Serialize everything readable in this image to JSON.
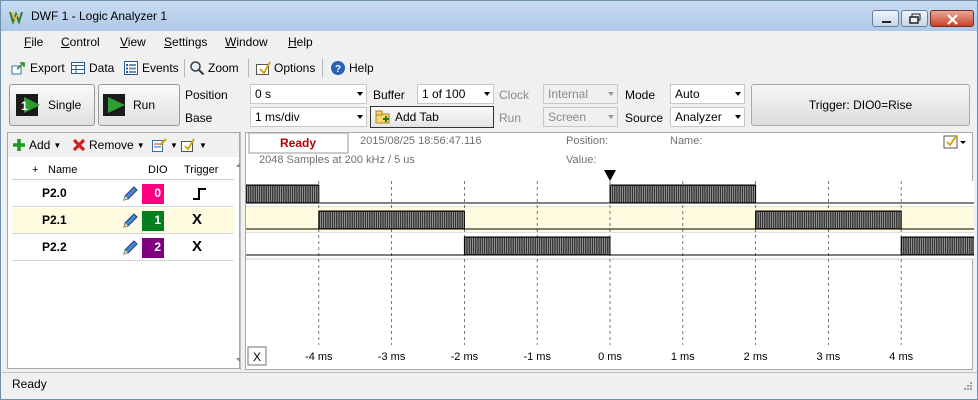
{
  "window": {
    "title": "DWF 1 - Logic Analyzer 1"
  },
  "menu": {
    "items": [
      {
        "first": "F",
        "rest": "ile"
      },
      {
        "first": "C",
        "rest": "ontrol"
      },
      {
        "first": "V",
        "rest": "iew"
      },
      {
        "first": "S",
        "rest": "ettings"
      },
      {
        "first": "W",
        "rest": "indow"
      },
      {
        "first": "H",
        "rest": "elp"
      }
    ]
  },
  "toolbar": {
    "export": "Export",
    "data": "Data",
    "events": "Events",
    "zoom": "Zoom",
    "options": "Options",
    "help": "Help"
  },
  "controls": {
    "single": "Single",
    "run": "Run",
    "position_label": "Position",
    "position_value": "0 s",
    "base_label": "Base",
    "base_value": "1 ms/div",
    "buffer_label": "Buffer",
    "buffer_value": "1 of 100",
    "add_tab": "Add Tab",
    "clock_label": "Clock",
    "clock_value": "Internal",
    "run_label": "Run",
    "run_value": "Screen",
    "mode_label": "Mode",
    "mode_value": "Auto",
    "source_label": "Source",
    "source_value": "Analyzer",
    "trigger_summary": "Trigger: DIO0=Rise"
  },
  "channels_panel": {
    "add": "Add",
    "remove": "Remove",
    "headers": {
      "plus": "+",
      "name": "Name",
      "dio": "DIO",
      "trigger": "Trigger"
    },
    "rows": [
      {
        "name": "P2.0",
        "dio": "0",
        "color": "#ff0080",
        "trigger": "rise"
      },
      {
        "name": "P2.1",
        "dio": "1",
        "color": "#007f1e",
        "trigger": "X"
      },
      {
        "name": "P2.2",
        "dio": "2",
        "color": "#800080",
        "trigger": "X"
      }
    ]
  },
  "plot": {
    "status": "Ready",
    "timestamp": "2015/08/25  18:56:47.116",
    "samples": "2048 Samples at 200 kHz / 5 us",
    "position_label": "Position:",
    "value_label": "Value:",
    "name_label": "Name:",
    "x_button": "X",
    "time_labels": [
      "-4 ms",
      "-3 ms",
      "-2 ms",
      "-1 ms",
      "0 ms",
      "1 ms",
      "2 ms",
      "3 ms",
      "4 ms"
    ],
    "time_ms": [
      -4,
      -3,
      -2,
      -1,
      0,
      1,
      2,
      3,
      4
    ],
    "range_ms": [
      -5,
      5
    ],
    "trigger_ms": 0,
    "signals": [
      {
        "name": "P2.0",
        "highlight": false,
        "activity_ms": [
          [
            -5,
            -4
          ],
          [
            0,
            2
          ]
        ]
      },
      {
        "name": "P2.1",
        "highlight": true,
        "activity_ms": [
          [
            -4,
            -2
          ],
          [
            2,
            4
          ]
        ]
      },
      {
        "name": "P2.2",
        "highlight": false,
        "activity_ms": [
          [
            -2,
            0
          ],
          [
            4,
            5
          ]
        ]
      }
    ]
  },
  "statusbar": {
    "text": "Ready"
  }
}
